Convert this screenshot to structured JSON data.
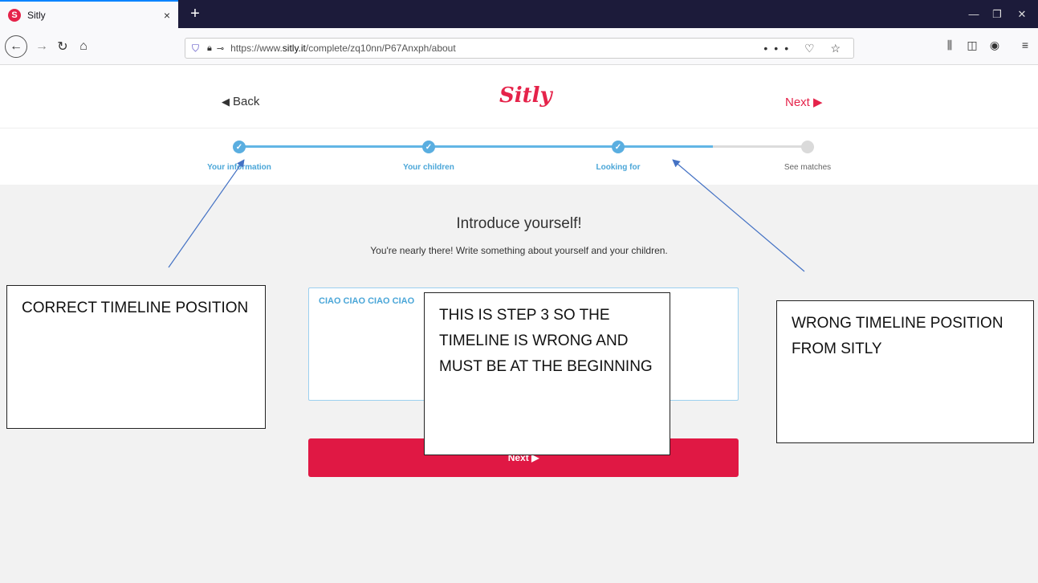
{
  "browser": {
    "tab_title": "Sitly",
    "tab_favicon": "S",
    "tab_close": "×",
    "new_tab": "+",
    "url_prefix": "https://www.",
    "url_domain": "sitly.it",
    "url_path": "/complete/zq10nn/P67Anxph/about",
    "url_icons": "••• ♡ ☆"
  },
  "header": {
    "back_label": "Back",
    "logo": "Sitly",
    "next_label": "Next"
  },
  "timeline": {
    "steps": [
      {
        "label": "Your information",
        "done": true
      },
      {
        "label": "Your children",
        "done": true
      },
      {
        "label": "Looking for",
        "done": true
      },
      {
        "label": "See matches",
        "done": false
      }
    ],
    "progress_fraction": 0.83
  },
  "main": {
    "title": "Introduce yourself!",
    "subtitle": "You're nearly there! Write something about yourself and your children.",
    "about_text": "CIAO CIAO CIAO CIAO",
    "next_button": "Next"
  },
  "annotations": {
    "left": "CORRECT TIMELINE POSITION",
    "center": "THIS IS STEP 3 SO THE TIMELINE IS WRONG AND MUST BE AT THE BEGINNING",
    "right": "WRONG TIMELINE POSITION FROM SITLY"
  },
  "colors": {
    "brand": "#e5234a",
    "timeline": "#5aaee0",
    "button": "#e01844",
    "arrow": "#4472c4"
  },
  "icons": [
    "back-arrow-icon",
    "forward-arrow-icon",
    "reload-icon",
    "home-icon",
    "shield-icon",
    "lock-icon",
    "key-icon",
    "library-icon",
    "sidebar-icon",
    "account-icon",
    "menu-icon",
    "check-icon"
  ]
}
